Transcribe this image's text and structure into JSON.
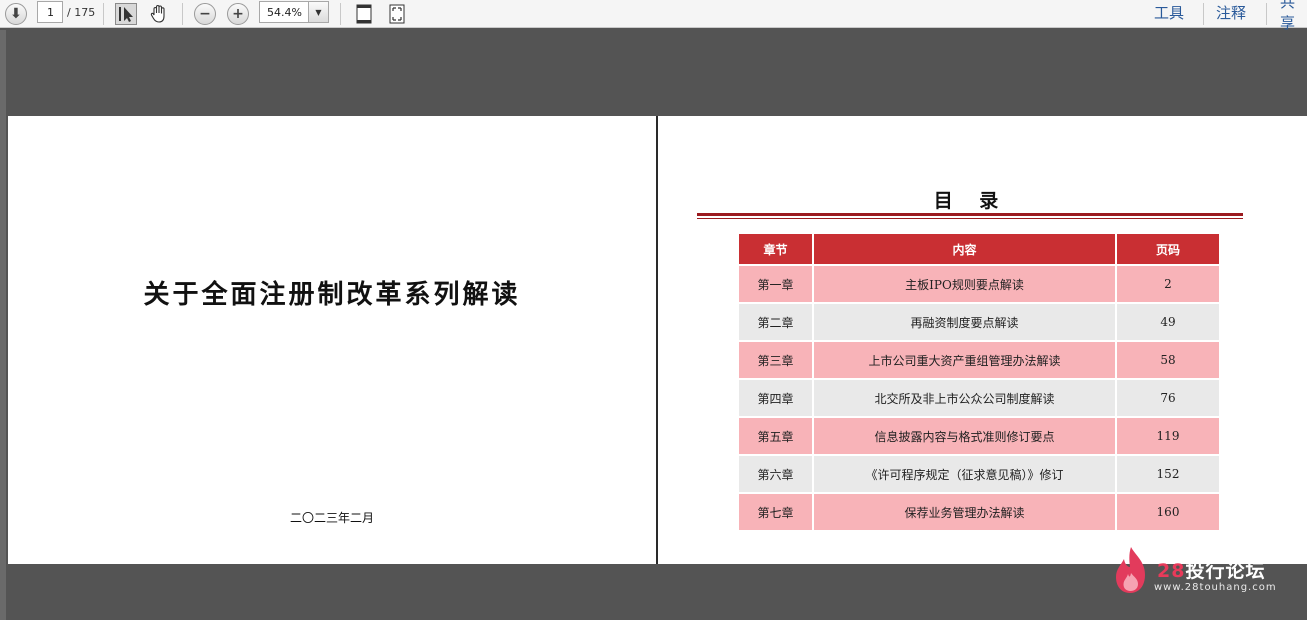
{
  "toolbar": {
    "page_current": "1",
    "page_total": "/ 175",
    "zoom_value": "54.4%",
    "tools_label": "工具",
    "comment_label": "注释",
    "share_label": "共享"
  },
  "left_page": {
    "title": "关于全面注册制改革系列解读",
    "date": "二〇二三年二月"
  },
  "right_page": {
    "toc_title": "目 录",
    "headers": [
      "章节",
      "内容",
      "页码"
    ],
    "rows": [
      {
        "chapter": "第一章",
        "content": "主板IPO规则要点解读",
        "page": "2"
      },
      {
        "chapter": "第二章",
        "content": "再融资制度要点解读",
        "page": "49"
      },
      {
        "chapter": "第三章",
        "content": "上市公司重大资产重组管理办法解读",
        "page": "58"
      },
      {
        "chapter": "第四章",
        "content": "北交所及非上市公众公司制度解读",
        "page": "76"
      },
      {
        "chapter": "第五章",
        "content": "信息披露内容与格式准则修订要点",
        "page": "119"
      },
      {
        "chapter": "第六章",
        "content": "《许可程序规定（征求意见稿）》修订",
        "page": "152"
      },
      {
        "chapter": "第七章",
        "content": "保荐业务管理办法解读",
        "page": "160"
      }
    ]
  },
  "watermark": {
    "num": "28",
    "text": "投行论坛",
    "url": "www.28touhang.com"
  },
  "colors": {
    "header_red": "#c92f33",
    "row_pink": "#f8b3b8",
    "row_grey": "#e9e9e9",
    "rule_red": "#9b1a1f",
    "link_blue": "#2a5a9a"
  }
}
